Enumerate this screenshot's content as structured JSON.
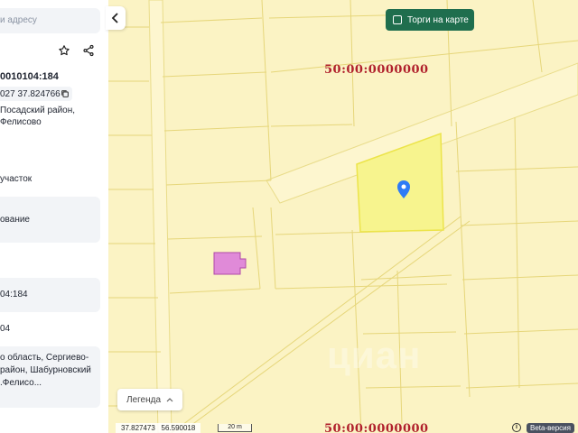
{
  "sidebar": {
    "search_placeholder": "и адресу",
    "cadastral_number": "0010104:184",
    "coords_text": "027 37.824766",
    "address_short_lines": [
      "Посадский район,",
      "Фелисово"
    ],
    "category_text": "участок",
    "usage_text": "ование",
    "number_repeat": "04:184",
    "short_value": "04",
    "full_address_lines": [
      "о область, Сергиево-",
      "район, Шабурновский",
      ".Фелисо..."
    ]
  },
  "map": {
    "cadastral_labels": [
      "50:00:0000000",
      "50:00:0000000"
    ],
    "auction_button": "Торги на карте",
    "legend_label": "Легенда",
    "watermark": "циан",
    "selected_parcel_color": "#f7f48e",
    "marker_color": "#2e7cf6",
    "purple_parcel_color": "#e08ad8"
  },
  "bottom_bar": {
    "lon": "37.827473",
    "lat": "56.590018",
    "scale_label": "20 m",
    "info_label": "i",
    "beta_label": "Beta-версия"
  }
}
